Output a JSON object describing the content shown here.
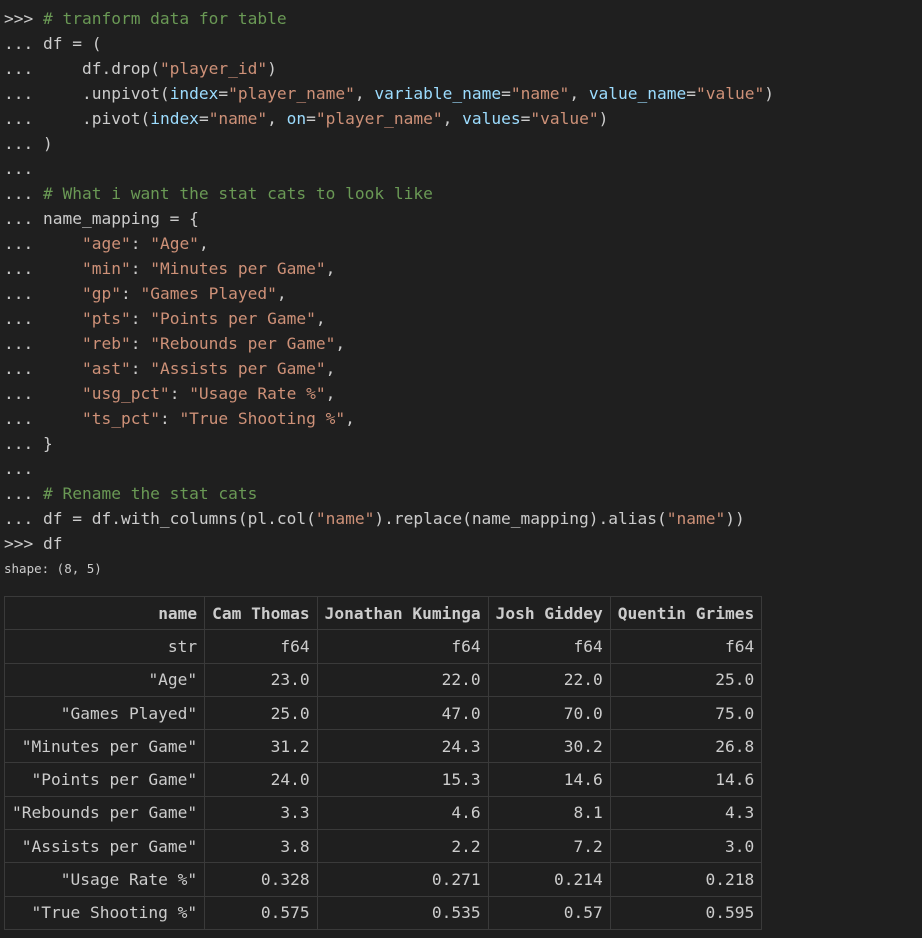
{
  "code_lines": [
    {
      "prompt": ">>> ",
      "segments": [
        {
          "t": "# tranform data for table",
          "c": "comment"
        }
      ]
    },
    {
      "prompt": "... ",
      "segments": [
        {
          "t": "df = (",
          "c": "plain"
        }
      ]
    },
    {
      "prompt": "...     ",
      "segments": [
        {
          "t": "df.drop(",
          "c": "plain"
        },
        {
          "t": "\"player_id\"",
          "c": "str"
        },
        {
          "t": ")",
          "c": "plain"
        }
      ]
    },
    {
      "prompt": "...     ",
      "segments": [
        {
          "t": ".unpivot(",
          "c": "plain"
        },
        {
          "t": "index",
          "c": "param"
        },
        {
          "t": "=",
          "c": "plain"
        },
        {
          "t": "\"player_name\"",
          "c": "str"
        },
        {
          "t": ", ",
          "c": "plain"
        },
        {
          "t": "variable_name",
          "c": "param"
        },
        {
          "t": "=",
          "c": "plain"
        },
        {
          "t": "\"name\"",
          "c": "str"
        },
        {
          "t": ", ",
          "c": "plain"
        },
        {
          "t": "value_name",
          "c": "param"
        },
        {
          "t": "=",
          "c": "plain"
        },
        {
          "t": "\"value\"",
          "c": "str"
        },
        {
          "t": ")",
          "c": "plain"
        }
      ]
    },
    {
      "prompt": "...     ",
      "segments": [
        {
          "t": ".pivot(",
          "c": "plain"
        },
        {
          "t": "index",
          "c": "param"
        },
        {
          "t": "=",
          "c": "plain"
        },
        {
          "t": "\"name\"",
          "c": "str"
        },
        {
          "t": ", ",
          "c": "plain"
        },
        {
          "t": "on",
          "c": "param"
        },
        {
          "t": "=",
          "c": "plain"
        },
        {
          "t": "\"player_name\"",
          "c": "str"
        },
        {
          "t": ", ",
          "c": "plain"
        },
        {
          "t": "values",
          "c": "param"
        },
        {
          "t": "=",
          "c": "plain"
        },
        {
          "t": "\"value\"",
          "c": "str"
        },
        {
          "t": ")",
          "c": "plain"
        }
      ]
    },
    {
      "prompt": "... ",
      "segments": [
        {
          "t": ")",
          "c": "plain"
        }
      ]
    },
    {
      "prompt": "...",
      "segments": []
    },
    {
      "prompt": "... ",
      "segments": [
        {
          "t": "# What i want the stat cats to look like",
          "c": "comment"
        }
      ]
    },
    {
      "prompt": "... ",
      "segments": [
        {
          "t": "name_mapping = {",
          "c": "plain"
        }
      ]
    },
    {
      "prompt": "...     ",
      "segments": [
        {
          "t": "\"age\"",
          "c": "str"
        },
        {
          "t": ": ",
          "c": "plain"
        },
        {
          "t": "\"Age\"",
          "c": "str"
        },
        {
          "t": ",",
          "c": "plain"
        }
      ]
    },
    {
      "prompt": "...     ",
      "segments": [
        {
          "t": "\"min\"",
          "c": "str"
        },
        {
          "t": ": ",
          "c": "plain"
        },
        {
          "t": "\"Minutes per Game\"",
          "c": "str"
        },
        {
          "t": ",",
          "c": "plain"
        }
      ]
    },
    {
      "prompt": "...     ",
      "segments": [
        {
          "t": "\"gp\"",
          "c": "str"
        },
        {
          "t": ": ",
          "c": "plain"
        },
        {
          "t": "\"Games Played\"",
          "c": "str"
        },
        {
          "t": ",",
          "c": "plain"
        }
      ]
    },
    {
      "prompt": "...     ",
      "segments": [
        {
          "t": "\"pts\"",
          "c": "str"
        },
        {
          "t": ": ",
          "c": "plain"
        },
        {
          "t": "\"Points per Game\"",
          "c": "str"
        },
        {
          "t": ",",
          "c": "plain"
        }
      ]
    },
    {
      "prompt": "...     ",
      "segments": [
        {
          "t": "\"reb\"",
          "c": "str"
        },
        {
          "t": ": ",
          "c": "plain"
        },
        {
          "t": "\"Rebounds per Game\"",
          "c": "str"
        },
        {
          "t": ",",
          "c": "plain"
        }
      ]
    },
    {
      "prompt": "...     ",
      "segments": [
        {
          "t": "\"ast\"",
          "c": "str"
        },
        {
          "t": ": ",
          "c": "plain"
        },
        {
          "t": "\"Assists per Game\"",
          "c": "str"
        },
        {
          "t": ",",
          "c": "plain"
        }
      ]
    },
    {
      "prompt": "...     ",
      "segments": [
        {
          "t": "\"usg_pct\"",
          "c": "str"
        },
        {
          "t": ": ",
          "c": "plain"
        },
        {
          "t": "\"Usage Rate %\"",
          "c": "str"
        },
        {
          "t": ",",
          "c": "plain"
        }
      ]
    },
    {
      "prompt": "...     ",
      "segments": [
        {
          "t": "\"ts_pct\"",
          "c": "str"
        },
        {
          "t": ": ",
          "c": "plain"
        },
        {
          "t": "\"True Shooting %\"",
          "c": "str"
        },
        {
          "t": ",",
          "c": "plain"
        }
      ]
    },
    {
      "prompt": "... ",
      "segments": [
        {
          "t": "}",
          "c": "plain"
        }
      ]
    },
    {
      "prompt": "...",
      "segments": []
    },
    {
      "prompt": "... ",
      "segments": [
        {
          "t": "# Rename the stat cats",
          "c": "comment"
        }
      ]
    },
    {
      "prompt": "... ",
      "segments": [
        {
          "t": "df = df.with_columns(pl.col(",
          "c": "plain"
        },
        {
          "t": "\"name\"",
          "c": "str"
        },
        {
          "t": ").replace(name_mapping).alias(",
          "c": "plain"
        },
        {
          "t": "\"name\"",
          "c": "str"
        },
        {
          "t": "))",
          "c": "plain"
        }
      ]
    },
    {
      "prompt": ">>> ",
      "segments": [
        {
          "t": "df",
          "c": "plain"
        }
      ]
    }
  ],
  "shape_text": "shape: (8, 5)",
  "table": {
    "headers": [
      "name",
      "Cam Thomas",
      "Jonathan Kuminga",
      "Josh Giddey",
      "Quentin Grimes"
    ],
    "dtypes": [
      "str",
      "f64",
      "f64",
      "f64",
      "f64"
    ],
    "rows": [
      [
        "\"Age\"",
        "23.0",
        "22.0",
        "22.0",
        "25.0"
      ],
      [
        "\"Games Played\"",
        "25.0",
        "47.0",
        "70.0",
        "75.0"
      ],
      [
        "\"Minutes per Game\"",
        "31.2",
        "24.3",
        "30.2",
        "26.8"
      ],
      [
        "\"Points per Game\"",
        "24.0",
        "15.3",
        "14.6",
        "14.6"
      ],
      [
        "\"Rebounds per Game\"",
        "3.3",
        "4.6",
        "8.1",
        "4.3"
      ],
      [
        "\"Assists per Game\"",
        "3.8",
        "2.2",
        "7.2",
        "3.0"
      ],
      [
        "\"Usage Rate %\"",
        "0.328",
        "0.271",
        "0.214",
        "0.218"
      ],
      [
        "\"True Shooting %\"",
        "0.575",
        "0.535",
        "0.57",
        "0.595"
      ]
    ]
  },
  "colors": {
    "background": "#1f1f1f",
    "comment": "#6a9955",
    "string": "#ce9178",
    "parameter": "#9cdcfe",
    "text": "#cccccc"
  }
}
